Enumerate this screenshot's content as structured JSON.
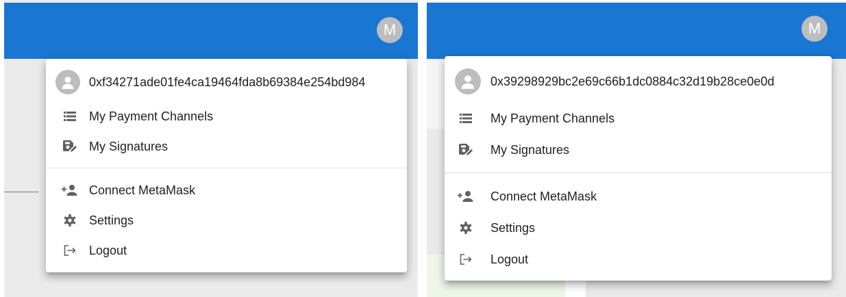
{
  "colors": {
    "appbar": "#1976d2",
    "avatar": "#bdbdbd",
    "icon": "#616161",
    "text": "#212121"
  },
  "left": {
    "avatar_letter": "M",
    "account": "0xf34271ade01fe4ca19464fda8b69384e254bd984",
    "menu": [
      {
        "label": "My Payment Channels",
        "icon": "list-icon"
      },
      {
        "label": "My Signatures",
        "icon": "signature-icon"
      },
      {
        "label": "Connect MetaMask",
        "icon": "add-person-icon"
      },
      {
        "label": "Settings",
        "icon": "gear-icon"
      },
      {
        "label": "Logout",
        "icon": "logout-icon"
      }
    ]
  },
  "right": {
    "avatar_letter": "M",
    "account": "0x39298929bc2e69c66b1dc0884c32d19b28ce0e0d",
    "menu": [
      {
        "label": "My Payment Channels",
        "icon": "list-icon"
      },
      {
        "label": "My Signatures",
        "icon": "signature-icon"
      },
      {
        "label": "Connect MetaMask",
        "icon": "add-person-icon"
      },
      {
        "label": "Settings",
        "icon": "gear-icon"
      },
      {
        "label": "Logout",
        "icon": "logout-icon"
      }
    ]
  }
}
